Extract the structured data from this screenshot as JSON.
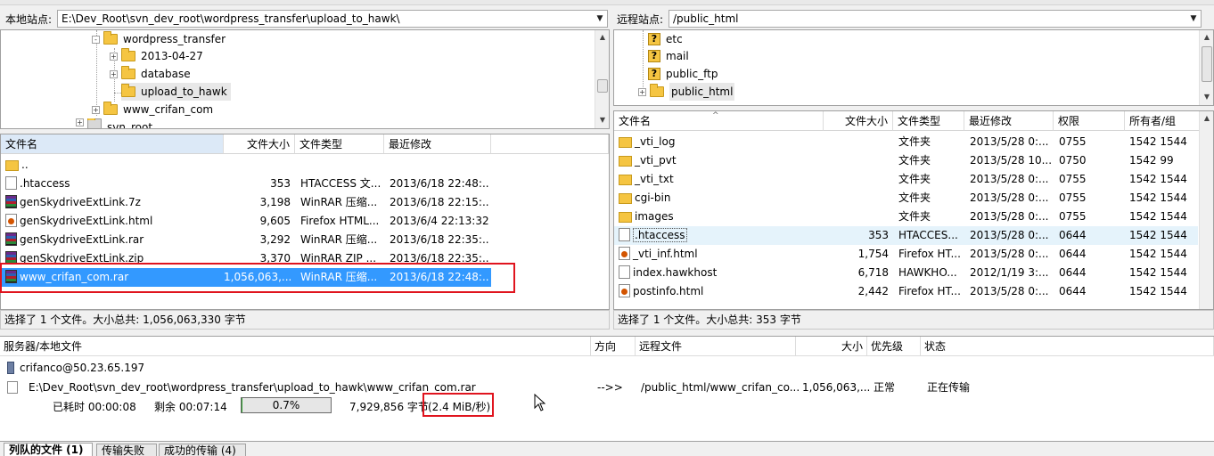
{
  "local_site": {
    "label": "本地站点:",
    "path": "E:\\Dev_Root\\svn_dev_root\\wordpress_transfer\\upload_to_hawk\\"
  },
  "remote_site": {
    "label": "远程站点:",
    "path": "/public_html"
  },
  "local_tree": {
    "items": [
      {
        "label": "wordpress_transfer"
      },
      {
        "label": "2013-04-27"
      },
      {
        "label": "database"
      },
      {
        "label": "upload_to_hawk"
      },
      {
        "label": "www_crifan_com"
      },
      {
        "label": "svn_root"
      }
    ],
    "expander_collapsed": "-",
    "expander_expanded": "+"
  },
  "remote_tree": {
    "items": [
      {
        "label": "etc"
      },
      {
        "label": "mail"
      },
      {
        "label": "public_ftp"
      },
      {
        "label": "public_html"
      }
    ],
    "unknown_icon": "?"
  },
  "local_list": {
    "columns": [
      "文件名",
      "文件大小",
      "文件类型",
      "最近修改"
    ],
    "rows": [
      {
        "name": "..",
        "size": "",
        "type": "",
        "modified": "",
        "icon": "folder-icon"
      },
      {
        "name": ".htaccess",
        "size": "353",
        "type": "HTACCESS 文...",
        "modified": "2013/6/18 22:48:...",
        "icon": "file-icon"
      },
      {
        "name": "genSkydriveExtLink.7z",
        "size": "3,198",
        "type": "WinRAR 压缩...",
        "modified": "2013/6/18 22:15:...",
        "icon": "winrar-icon"
      },
      {
        "name": "genSkydriveExtLink.html",
        "size": "9,605",
        "type": "Firefox HTML...",
        "modified": "2013/6/4 22:13:32",
        "icon": "firefox-html-icon"
      },
      {
        "name": "genSkydriveExtLink.rar",
        "size": "3,292",
        "type": "WinRAR 压缩...",
        "modified": "2013/6/18 22:35:...",
        "icon": "winrar-icon"
      },
      {
        "name": "genSkydriveExtLink.zip",
        "size": "3,370",
        "type": "WinRAR ZIP ...",
        "modified": "2013/6/18 22:35:...",
        "icon": "winrar-icon"
      },
      {
        "name": "www_crifan_com.rar",
        "size": "1,056,063,...",
        "type": "WinRAR 压缩...",
        "modified": "2013/6/18 22:48:...",
        "icon": "winrar-icon"
      }
    ],
    "status": "选择了 1 个文件。大小总共: 1,056,063,330 字节"
  },
  "remote_list": {
    "columns": [
      "文件名",
      "文件大小",
      "文件类型",
      "最近修改",
      "权限",
      "所有者/组"
    ],
    "rows": [
      {
        "name": "_vti_log",
        "size": "",
        "type": "文件夹",
        "modified": "2013/5/28 0:...",
        "perm": "0755",
        "owner": "1542 1544",
        "icon": "folder-icon"
      },
      {
        "name": "_vti_pvt",
        "size": "",
        "type": "文件夹",
        "modified": "2013/5/28 10...",
        "perm": "0750",
        "owner": "1542 99",
        "icon": "folder-icon"
      },
      {
        "name": "_vti_txt",
        "size": "",
        "type": "文件夹",
        "modified": "2013/5/28 0:...",
        "perm": "0755",
        "owner": "1542 1544",
        "icon": "folder-icon"
      },
      {
        "name": "cgi-bin",
        "size": "",
        "type": "文件夹",
        "modified": "2013/5/28 0:...",
        "perm": "0755",
        "owner": "1542 1544",
        "icon": "folder-icon"
      },
      {
        "name": "images",
        "size": "",
        "type": "文件夹",
        "modified": "2013/5/28 0:...",
        "perm": "0755",
        "owner": "1542 1544",
        "icon": "folder-icon"
      },
      {
        "name": ".htaccess",
        "size": "353",
        "type": "HTACCES...",
        "modified": "2013/5/28 0:...",
        "perm": "0644",
        "owner": "1542 1544",
        "icon": "file-icon"
      },
      {
        "name": "_vti_inf.html",
        "size": "1,754",
        "type": "Firefox HT...",
        "modified": "2013/5/28 0:...",
        "perm": "0644",
        "owner": "1542 1544",
        "icon": "firefox-html-icon"
      },
      {
        "name": "index.hawkhost",
        "size": "6,718",
        "type": "HAWKHO...",
        "modified": "2012/1/19 3:...",
        "perm": "0644",
        "owner": "1542 1544",
        "icon": "file-icon"
      },
      {
        "name": "postinfo.html",
        "size": "2,442",
        "type": "Firefox HT...",
        "modified": "2013/5/28 0:...",
        "perm": "0644",
        "owner": "1542 1544",
        "icon": "firefox-html-icon"
      }
    ],
    "status": "选择了 1 个文件。大小总共: 353 字节"
  },
  "queue": {
    "columns": [
      "服务器/本地文件",
      "方向",
      "远程文件",
      "大小",
      "优先级",
      "状态"
    ],
    "server": "crifanco@50.23.65.197",
    "local_file": "E:\\Dev_Root\\svn_dev_root\\wordpress_transfer\\upload_to_hawk\\www_crifan_com.rar",
    "direction": "-->>",
    "remote_file": "/public_html/www_crifan_co...",
    "size": "1,056,063,...",
    "priority": "正常",
    "status": "正在传输",
    "elapsed": "已耗时 00:00:08",
    "remaining": "剩余 00:07:14",
    "progress_label": "0.7%",
    "progress_fraction": 0.007,
    "bytes": "7,929,856 字节",
    "speed": "(2.4 MiB/秒)"
  },
  "tabs": [
    "列队的文件 (1)",
    "传输失败",
    "成功的传输 (4)"
  ],
  "ui": {
    "combo_arrow": "▼",
    "scroll_up": "▲",
    "scroll_down": "▼",
    "sort_caret": "^"
  },
  "colors": {
    "highlight": "#e0141e",
    "selection": "#3399ff",
    "folder": "#f5c542"
  }
}
